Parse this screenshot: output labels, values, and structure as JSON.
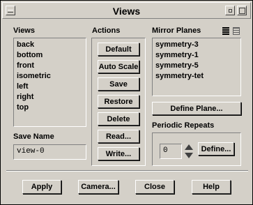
{
  "window": {
    "title": "Views"
  },
  "views": {
    "label": "Views",
    "items": [
      "back",
      "bottom",
      "front",
      "isometric",
      "left",
      "right",
      "top"
    ]
  },
  "save_name": {
    "label": "Save Name",
    "value": "view-0"
  },
  "actions": {
    "label": "Actions",
    "buttons": [
      "Default",
      "Auto Scale",
      "Save",
      "Restore",
      "Delete",
      "Read...",
      "Write..."
    ]
  },
  "mirror_planes": {
    "label": "Mirror Planes",
    "items": [
      "symmetry-3",
      "symmetry-1",
      "symmetry-5",
      "symmetry-tet"
    ],
    "define_plane": "Define Plane..."
  },
  "periodic_repeats": {
    "label": "Periodic Repeats",
    "value": "0",
    "define": "Define..."
  },
  "footer": {
    "apply": "Apply",
    "camera": "Camera...",
    "close": "Close",
    "help": "Help"
  }
}
